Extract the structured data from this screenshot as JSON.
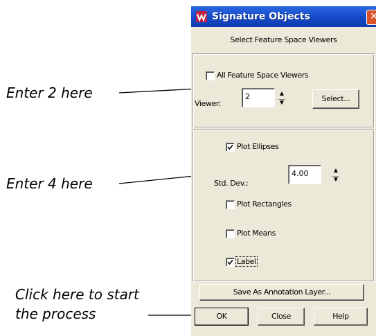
{
  "window": {
    "title": "Signature Objects",
    "close_glyph": "✕",
    "subtitle": "Select Feature Space Viewers"
  },
  "viewers": {
    "all_viewers_label": "All Feature Space Viewers",
    "all_viewers_checked": false,
    "viewer_label": "Viewer:",
    "viewer_value": "2",
    "select_button": "Select..."
  },
  "plot": {
    "ellipses_label": "Plot Ellipses",
    "ellipses_checked": true,
    "std_dev_label": "Std. Dev.:",
    "std_dev_value": "4.00",
    "rectangles_label": "Plot Rectangles",
    "rectangles_checked": false,
    "means_label": "Plot Means",
    "means_checked": false,
    "label_label": "Label",
    "label_checked": true
  },
  "buttons": {
    "save_annotation": "Save As Annotation Layer...",
    "ok": "OK",
    "close": "Close",
    "help": "Help"
  },
  "annotations": {
    "enter2": "Enter 2 here",
    "enter4": "Enter 4 here",
    "click_line1": "Click here to start",
    "click_line2": "the process"
  },
  "icons": {
    "app": "signature-objects-app-icon",
    "check": "checkmark-icon",
    "spin_up": "spin-up-icon",
    "spin_down": "spin-down-icon"
  },
  "colors": {
    "titlebar": "#1548c8",
    "dialog_bg": "#ece9d8",
    "close_button": "#d9542b"
  }
}
